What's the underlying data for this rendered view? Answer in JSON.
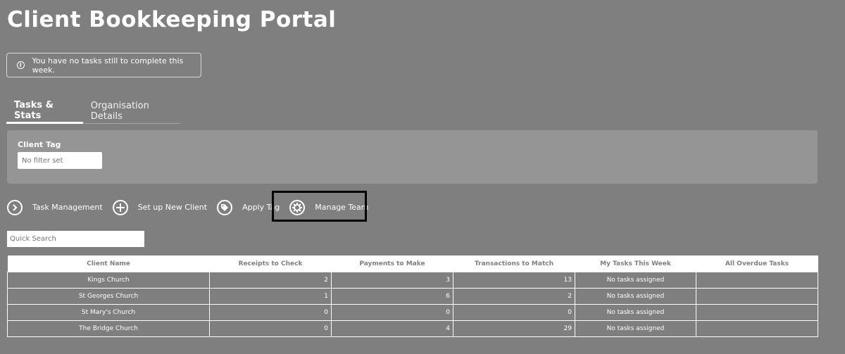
{
  "header": {
    "title": "Client Bookkeeping Portal"
  },
  "notice": {
    "text": "You have no tasks still to complete this week.",
    "icon": "info-icon"
  },
  "tabs": [
    {
      "label": "Tasks & Stats",
      "active": true
    },
    {
      "label": "Organisation Details",
      "active": false
    }
  ],
  "filter": {
    "label": "Client Tag",
    "placeholder": "No filter set"
  },
  "actions": {
    "task_management": "Task Management",
    "new_client": "Set up New Client",
    "apply_tag": "Apply Tag",
    "manage_team": "Manage Team"
  },
  "search": {
    "placeholder": "Quick Search"
  },
  "table": {
    "headers": [
      "Client Name",
      "Receipts to Check",
      "Payments to Make",
      "Transactions to Match",
      "My Tasks This Week",
      "All Overdue Tasks"
    ],
    "rows": [
      [
        "Kings Church",
        "2",
        "3",
        "13",
        "No tasks assigned",
        ""
      ],
      [
        "St Georges Church",
        "1",
        "6",
        "2",
        "No tasks assigned",
        ""
      ],
      [
        "St Mary's Church",
        "0",
        "0",
        "0",
        "No tasks assigned",
        ""
      ],
      [
        "The Bridge Church",
        "0",
        "4",
        "29",
        "No tasks assigned",
        ""
      ]
    ]
  }
}
